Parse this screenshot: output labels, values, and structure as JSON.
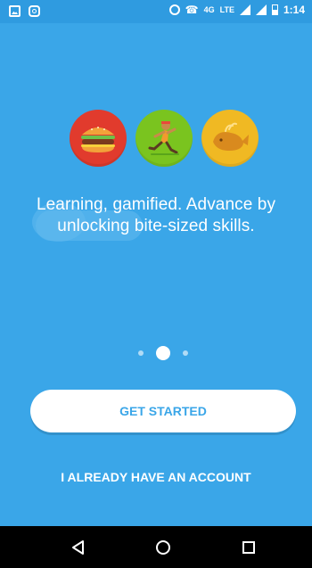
{
  "status_bar": {
    "time": "1:14",
    "network": "LTE",
    "network_small": "4G",
    "icons": [
      "gallery-icon",
      "instagram-icon",
      "hotspot-icon",
      "call-icon",
      "signal-icon",
      "battery-icon"
    ]
  },
  "onboarding": {
    "illustrations": [
      "hamburger-icon",
      "runner-icon",
      "whale-icon"
    ],
    "illustration_colors": [
      "#e13b2d",
      "#7ac41f",
      "#f0b923"
    ],
    "headline": "Learning, gamified. Advance by unlocking bite-sized skills.",
    "page_indicator": {
      "total": 3,
      "active": 2
    }
  },
  "actions": {
    "primary_label": "GET STARTED",
    "secondary_label": "I ALREADY HAVE AN ACCOUNT"
  },
  "colors": {
    "background": "#3aa6e8",
    "button_bg": "#ffffff",
    "button_text": "#3aa6e8"
  },
  "nav_bar": {
    "buttons": [
      "back-icon",
      "home-icon",
      "recents-icon"
    ]
  }
}
